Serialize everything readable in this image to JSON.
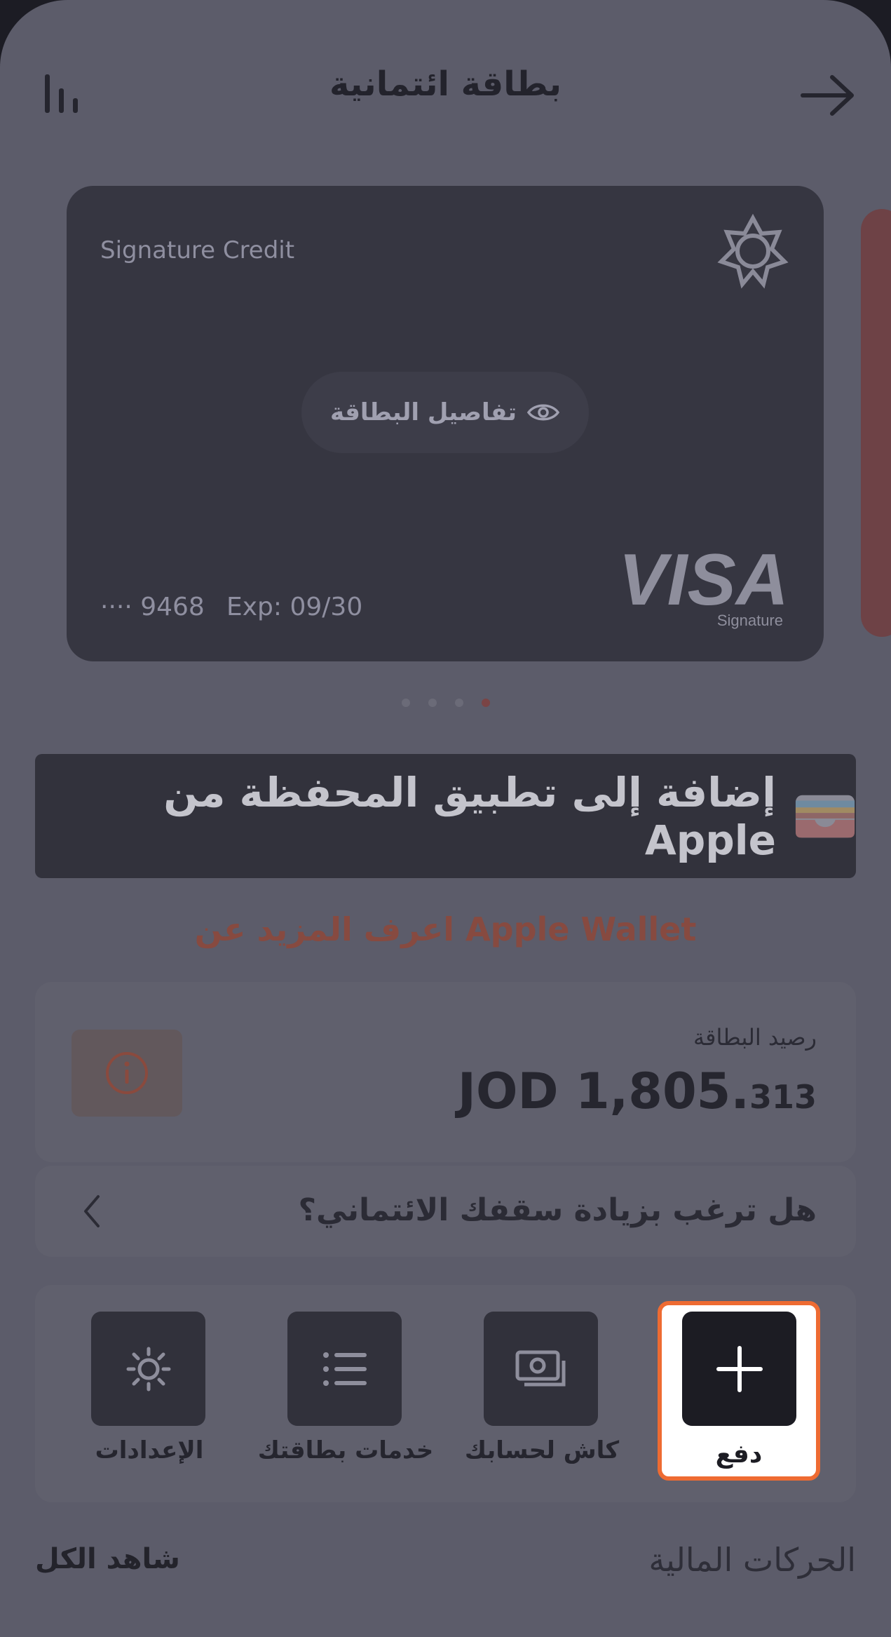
{
  "header": {
    "title": "بطاقة ائتمانية"
  },
  "card": {
    "type_label": "Signature Credit",
    "details_button": "تفاصيل البطاقة",
    "number": "···· 9468",
    "expiry": "Exp: 09/30",
    "brand": "VISA",
    "brand_sub": "Signature"
  },
  "pager": {
    "count": 4,
    "active": 0
  },
  "wallet": {
    "add_label": "إضافة إلى تطبيق المحفظة من Apple",
    "learn_more": "اعرف المزيد عن Apple Wallet"
  },
  "balance": {
    "label": "رصيد البطاقة",
    "currency": "JOD",
    "whole": "1,805.",
    "decimal": "313"
  },
  "limit": {
    "question": "هل ترغب بزيادة سقفك الائتماني؟"
  },
  "actions": [
    {
      "label": "دفع",
      "icon": "plus-icon"
    },
    {
      "label": "كاش لحسابك",
      "icon": "cash-icon"
    },
    {
      "label": "خدمات بطاقتك",
      "icon": "list-icon"
    },
    {
      "label": "الإعدادات",
      "icon": "gear-icon"
    }
  ],
  "transactions": {
    "title": "الحركات المالية",
    "see_all": "شاهد الكل"
  },
  "colors": {
    "accent": "#ee6b32",
    "screen_overlay": "#5c5c6a",
    "card": "#363641"
  }
}
